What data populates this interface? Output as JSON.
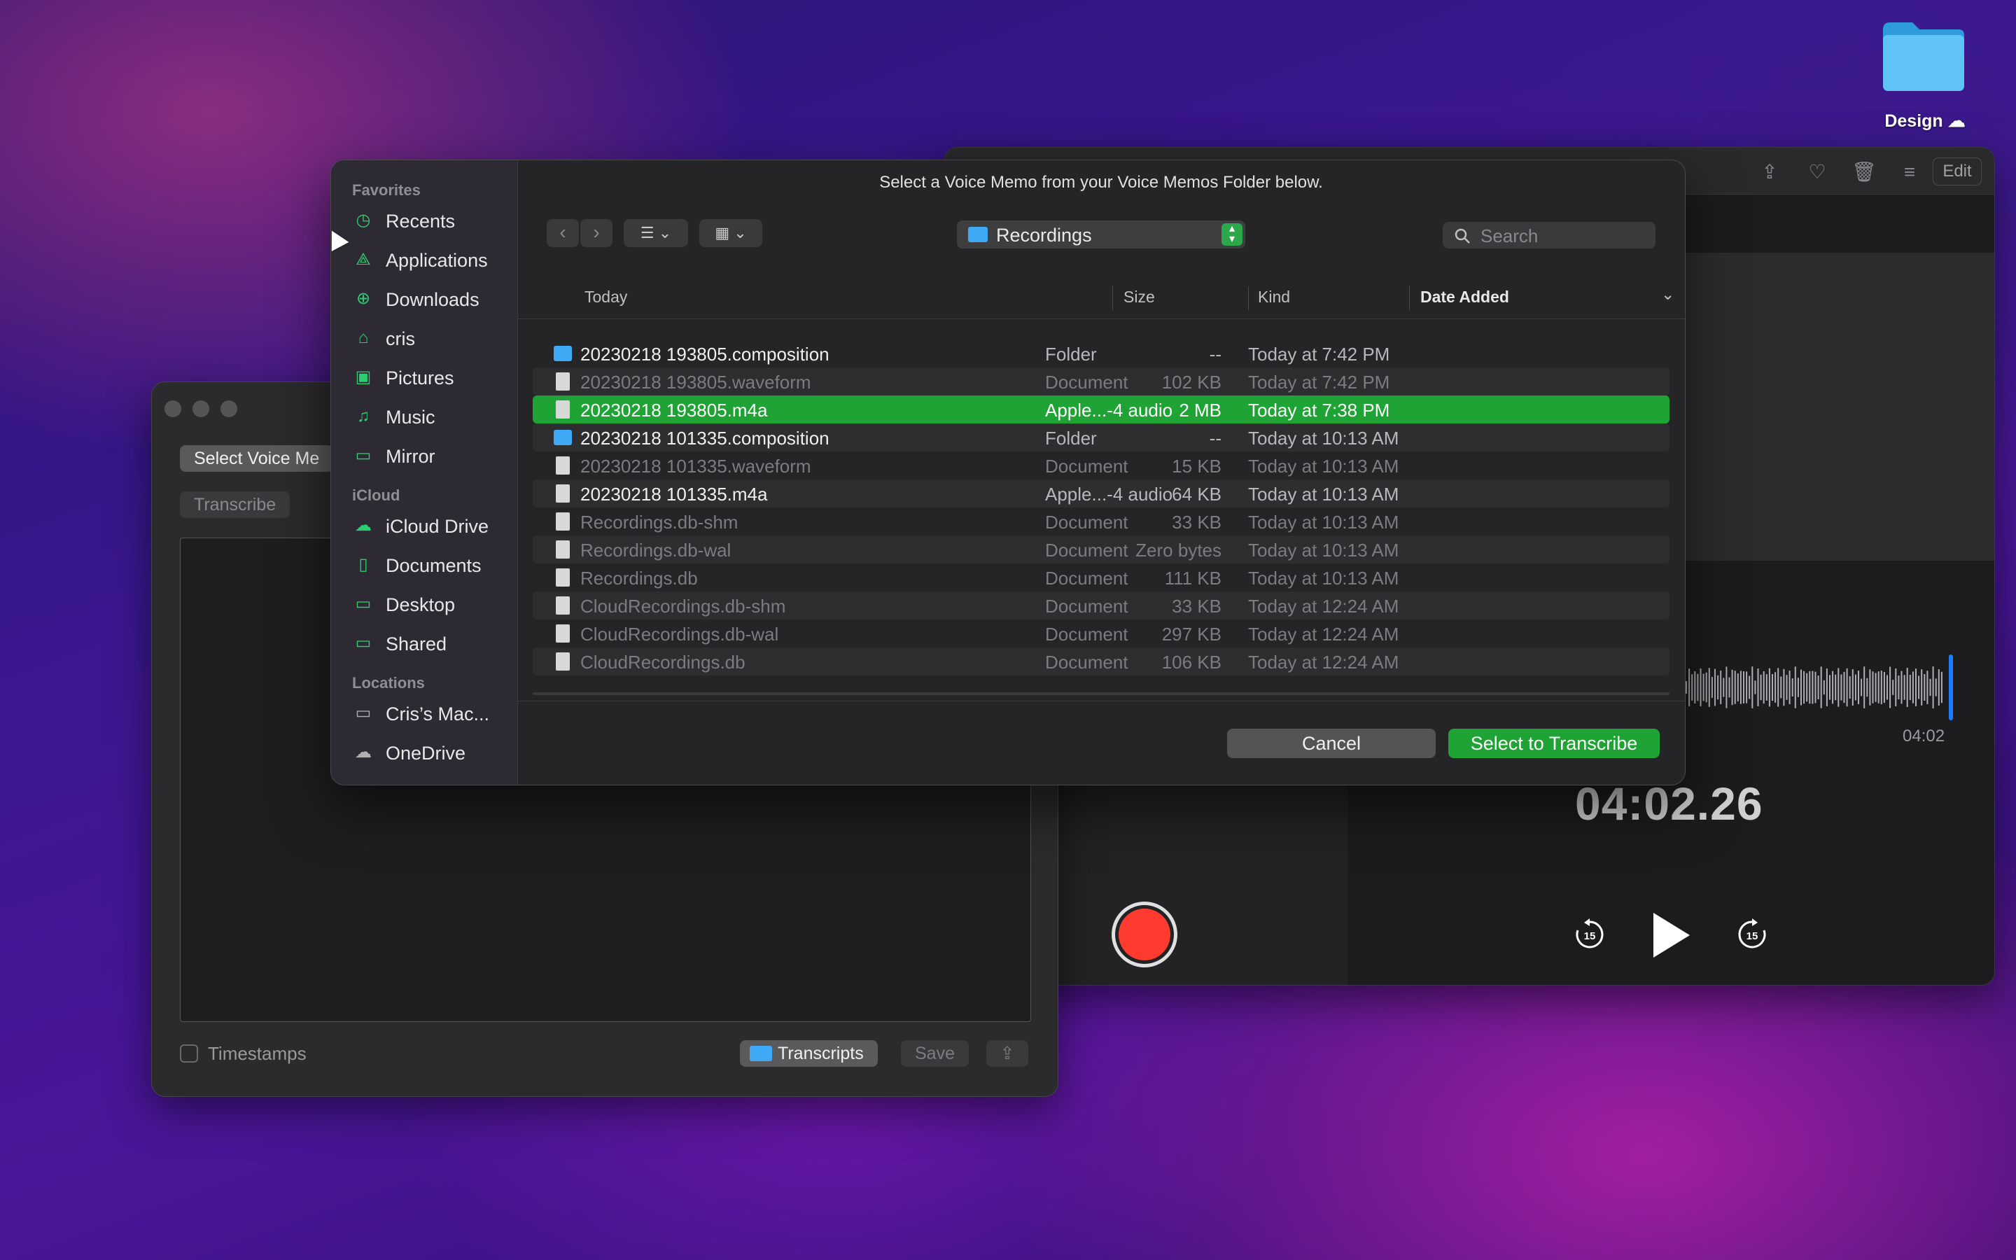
{
  "desktop": {
    "folder_label": "Design"
  },
  "voice_memos": {
    "edit_label": "Edit",
    "end_time": "04:02",
    "current_time": "04:02.26",
    "skip_back_label": "15",
    "skip_fwd_label": "15"
  },
  "transcriber": {
    "select_button": "Select Voice Me",
    "transcribe_button": "Transcribe",
    "timestamps_label": "Timestamps",
    "transcripts_button": "Transcripts",
    "save_button": "Save"
  },
  "dialog": {
    "message": "Select a Voice Memo from your Voice Memos Folder below.",
    "path": "Recordings",
    "search_placeholder": "Search",
    "sidebar": {
      "favorites_header": "Favorites",
      "favorites": [
        {
          "label": "Recents",
          "icon": "clock-icon"
        },
        {
          "label": "Applications",
          "icon": "applications-icon"
        },
        {
          "label": "Downloads",
          "icon": "download-icon"
        },
        {
          "label": "cris",
          "icon": "home-icon"
        },
        {
          "label": "Pictures",
          "icon": "pictures-icon"
        },
        {
          "label": "Music",
          "icon": "music-icon"
        },
        {
          "label": "Mirror",
          "icon": "folder-icon"
        }
      ],
      "icloud_header": "iCloud",
      "icloud": [
        {
          "label": "iCloud Drive",
          "icon": "cloud-icon"
        },
        {
          "label": "Documents",
          "icon": "document-icon"
        },
        {
          "label": "Desktop",
          "icon": "desktop-icon"
        },
        {
          "label": "Shared",
          "icon": "shared-folder-icon"
        }
      ],
      "locations_header": "Locations",
      "locations": [
        {
          "label": "Cris’s Mac...",
          "icon": "laptop-icon"
        },
        {
          "label": "OneDrive",
          "icon": "cloud-icon"
        }
      ]
    },
    "columns": {
      "name": "Today",
      "size": "Size",
      "kind": "Kind",
      "date": "Date Added"
    },
    "files": [
      {
        "name": "20230218 193805.composition",
        "size": "--",
        "kind": "Folder",
        "date": "Today at 7:42 PM",
        "type": "folder",
        "dim": false,
        "selected": false
      },
      {
        "name": "20230218 193805.waveform",
        "size": "102 KB",
        "kind": "Document",
        "date": "Today at 7:42 PM",
        "type": "doc",
        "dim": true,
        "selected": false
      },
      {
        "name": "20230218 193805.m4a",
        "size": "2 MB",
        "kind": "Apple...-4 audio",
        "date": "Today at 7:38 PM",
        "type": "audio",
        "dim": false,
        "selected": true
      },
      {
        "name": "20230218 101335.composition",
        "size": "--",
        "kind": "Folder",
        "date": "Today at 10:13 AM",
        "type": "folder",
        "dim": false,
        "selected": false
      },
      {
        "name": "20230218 101335.waveform",
        "size": "15 KB",
        "kind": "Document",
        "date": "Today at 10:13 AM",
        "type": "doc",
        "dim": true,
        "selected": false
      },
      {
        "name": "20230218 101335.m4a",
        "size": "64 KB",
        "kind": "Apple...-4 audio",
        "date": "Today at 10:13 AM",
        "type": "audio",
        "dim": false,
        "selected": false
      },
      {
        "name": "Recordings.db-shm",
        "size": "33 KB",
        "kind": "Document",
        "date": "Today at 10:13 AM",
        "type": "doc",
        "dim": true,
        "selected": false
      },
      {
        "name": "Recordings.db-wal",
        "size": "Zero bytes",
        "kind": "Document",
        "date": "Today at 10:13 AM",
        "type": "doc",
        "dim": true,
        "selected": false
      },
      {
        "name": "Recordings.db",
        "size": "111 KB",
        "kind": "Document",
        "date": "Today at 10:13 AM",
        "type": "doc",
        "dim": true,
        "selected": false
      },
      {
        "name": "CloudRecordings.db-shm",
        "size": "33 KB",
        "kind": "Document",
        "date": "Today at 12:24 AM",
        "type": "doc",
        "dim": true,
        "selected": false
      },
      {
        "name": "CloudRecordings.db-wal",
        "size": "297 KB",
        "kind": "Document",
        "date": "Today at 12:24 AM",
        "type": "doc",
        "dim": true,
        "selected": false
      },
      {
        "name": "CloudRecordings.db",
        "size": "106 KB",
        "kind": "Document",
        "date": "Today at 12:24 AM",
        "type": "doc",
        "dim": true,
        "selected": false
      }
    ],
    "cancel_button": "Cancel",
    "confirm_button": "Select to Transcribe"
  },
  "colors": {
    "accent": "#1fa335",
    "record": "#ff3b30",
    "folder": "#3fa9f5",
    "playhead": "#1a7dff"
  }
}
